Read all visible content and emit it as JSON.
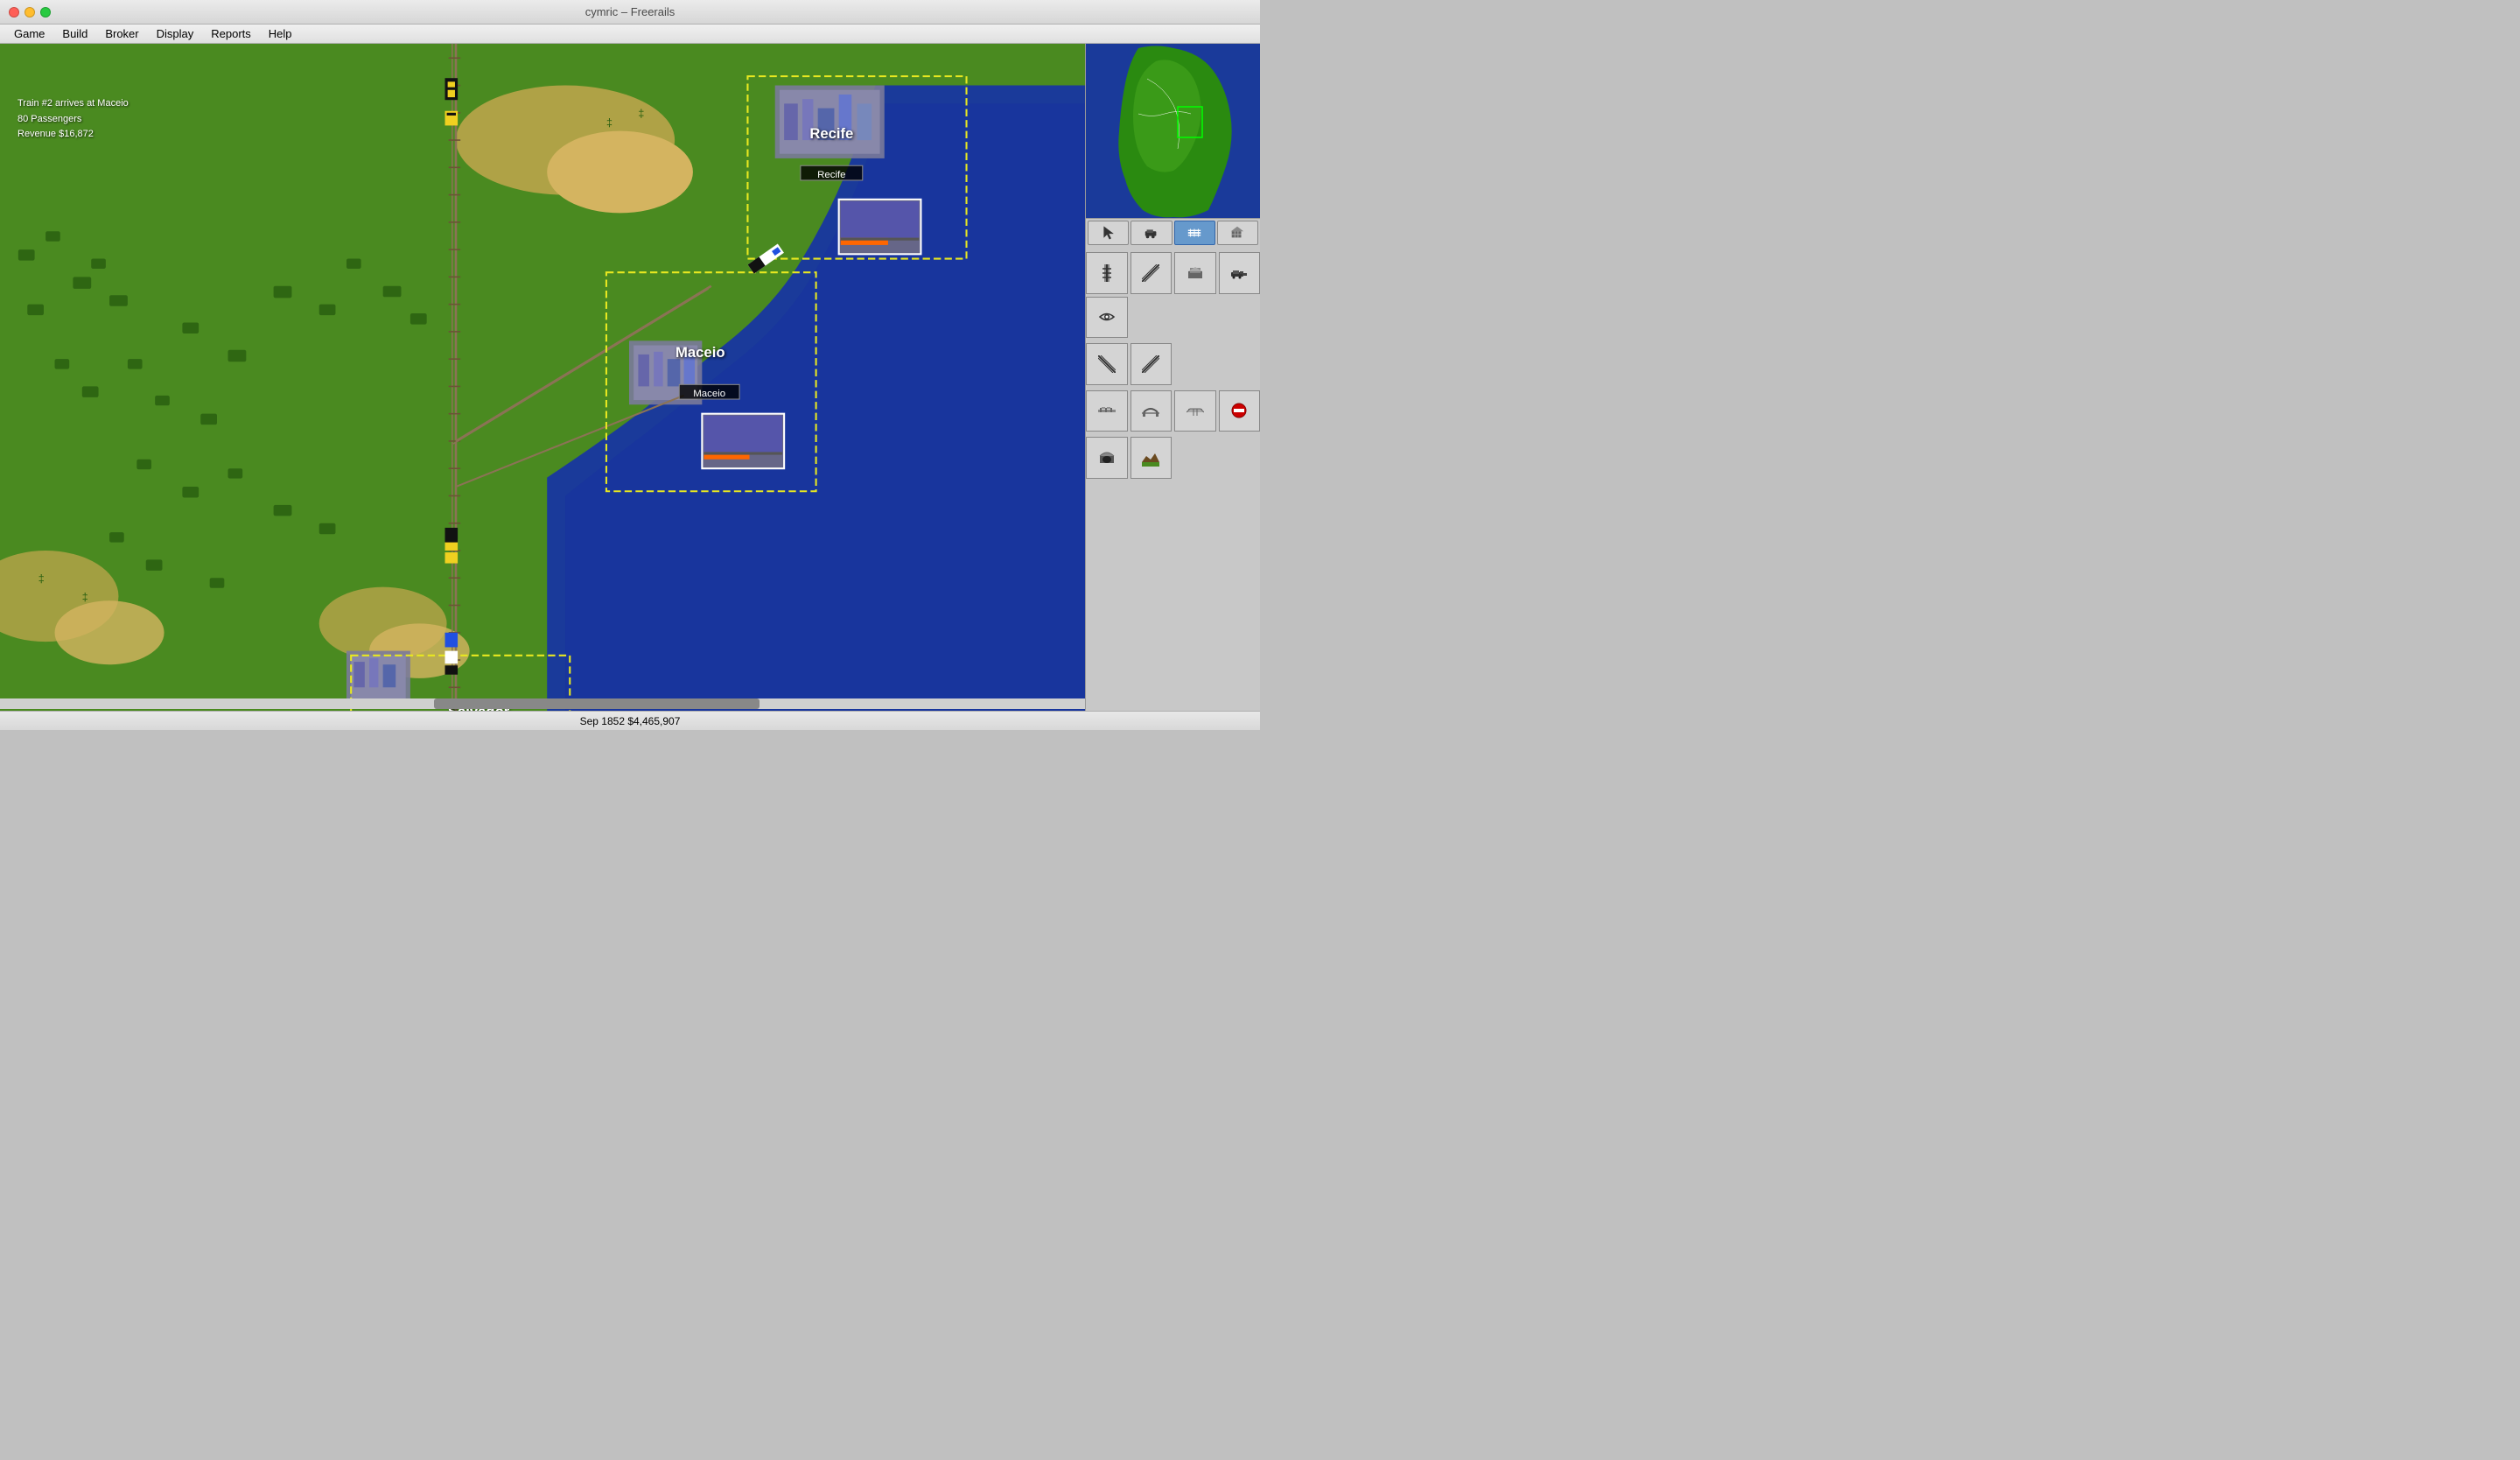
{
  "window": {
    "title": "cymric – Freerails"
  },
  "titlebar_buttons": {
    "close": "close",
    "minimize": "minimize",
    "maximize": "maximize"
  },
  "menubar": {
    "items": [
      "Game",
      "Build",
      "Broker",
      "Display",
      "Reports",
      "Help"
    ]
  },
  "notification": {
    "line1": "Train #2 arrives at Maceio",
    "line2": "80 Passengers",
    "line3": "Revenue $16,872"
  },
  "cities": [
    {
      "name": "Recife",
      "label": "Recife"
    },
    {
      "name": "Maceio",
      "label": "Maceio"
    },
    {
      "name": "Salvador",
      "label": "Salvador"
    }
  ],
  "statusbar": {
    "text": "Sep 1852  $4,465,907"
  },
  "mode_buttons": [
    {
      "id": "build-track",
      "icon": "⛏"
    },
    {
      "id": "build-station",
      "icon": "🏗"
    },
    {
      "id": "build-train",
      "icon": "🚂"
    },
    {
      "id": "bulldoze",
      "icon": "🔨"
    }
  ],
  "tools": {
    "row1": [
      "track-ne",
      "track-nw",
      "station",
      "engine",
      "eye"
    ],
    "row2": [
      "track-diag1",
      "track-diag2"
    ],
    "row3": [
      "bridge-flat",
      "bridge-arch",
      "bridge-end",
      "no-entry"
    ],
    "row4": [
      "tunnel",
      "terraform"
    ]
  },
  "minimap": {
    "viewport_left": "72%",
    "viewport_top": "40%",
    "viewport_width": "15%",
    "viewport_height": "20%"
  }
}
